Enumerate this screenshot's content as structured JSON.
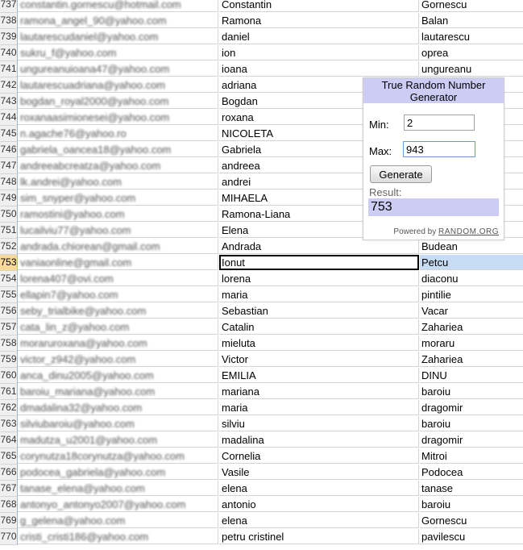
{
  "rows": [
    {
      "n": "737",
      "email": "constantin.gornescu@hotmail.com",
      "first": "Constantin",
      "last": "Gornescu"
    },
    {
      "n": "738",
      "email": "ramona_angel_90@yahoo.com",
      "first": "Ramona",
      "last": "Balan"
    },
    {
      "n": "739",
      "email": "lautarescudaniel@yahoo.com",
      "first": "daniel",
      "last": "lautarescu"
    },
    {
      "n": "740",
      "email": "sukru_f@yahoo.com",
      "first": "ion",
      "last": "oprea"
    },
    {
      "n": "741",
      "email": "ungureanuioana47@yahoo.com",
      "first": "ioana",
      "last": "ungureanu"
    },
    {
      "n": "742",
      "email": "lautarescuadriana@yahoo.com",
      "first": "adriana",
      "last": ""
    },
    {
      "n": "743",
      "email": "bogdan_royal2000@yahoo.com",
      "first": "Bogdan",
      "last": ""
    },
    {
      "n": "744",
      "email": "roxanaasimionesei@yahoo.com",
      "first": "roxana",
      "last": ""
    },
    {
      "n": "745",
      "email": "n.agache76@yahoo.ro",
      "first": "NICOLETA",
      "last": ""
    },
    {
      "n": "746",
      "email": "gabriela_oancea18@yahoo.com",
      "first": "Gabriela",
      "last": ""
    },
    {
      "n": "747",
      "email": "andreeabcreatza@yahoo.com",
      "first": "andreea",
      "last": ""
    },
    {
      "n": "748",
      "email": "lk.andrei@yahoo.com",
      "first": "andrei",
      "last": ""
    },
    {
      "n": "749",
      "email": "sim_snyper@yahoo.com",
      "first": "MIHAELA",
      "last": ""
    },
    {
      "n": "750",
      "email": "ramostini@yahoo.com",
      "first": "Ramona-Liana",
      "last": ""
    },
    {
      "n": "751",
      "email": "lucailviu77@yahoo.com",
      "first": "Elena",
      "last": ""
    },
    {
      "n": "752",
      "email": "andrada.chiorean@gmail.com",
      "first": "Andrada",
      "last": "Budean"
    },
    {
      "n": "753",
      "email": "vaniaonline@gmail.com",
      "first": "Ionut",
      "last": "Petcu"
    },
    {
      "n": "754",
      "email": "lorena407@ovi.com",
      "first": "lorena",
      "last": "diaconu"
    },
    {
      "n": "755",
      "email": "ellapin7@yahoo.com",
      "first": "maria",
      "last": "pintilie"
    },
    {
      "n": "756",
      "email": "seby_trialbike@yahoo.com",
      "first": "Sebastian",
      "last": "Vacar"
    },
    {
      "n": "757",
      "email": "cata_lin_z@yahoo.com",
      "first": "Catalin",
      "last": "Zahariea"
    },
    {
      "n": "758",
      "email": "moraruroxana@yahoo.com",
      "first": "mieluta",
      "last": "moraru"
    },
    {
      "n": "759",
      "email": "victor_z942@yahoo.com",
      "first": "Victor",
      "last": "Zahariea"
    },
    {
      "n": "760",
      "email": "anca_dinu2005@yahoo.com",
      "first": "EMILIA",
      "last": "DINU"
    },
    {
      "n": "761",
      "email": "baroiu_mariana@yahoo.com",
      "first": "mariana",
      "last": "baroiu"
    },
    {
      "n": "762",
      "email": "dmadalina32@yahoo.com",
      "first": "maria",
      "last": "dragomir"
    },
    {
      "n": "763",
      "email": "silviubaroiu@yahoo.com",
      "first": "silviu",
      "last": "baroiu"
    },
    {
      "n": "764",
      "email": "madutza_u2001@yahoo.com",
      "first": "madalina",
      "last": "dragomir"
    },
    {
      "n": "765",
      "email": "corynutza18corynutza@yahoo.com",
      "first": "Cornelia",
      "last": "Mitroi"
    },
    {
      "n": "766",
      "email": "podocea_gabriela@yahoo.com",
      "first": "Vasile",
      "last": "Podocea"
    },
    {
      "n": "767",
      "email": "tanase_elena@yahoo.com",
      "first": "elena",
      "last": "tanase"
    },
    {
      "n": "768",
      "email": "antonyo_antonyo2007@yahoo.com",
      "first": "antonio",
      "last": "baroiu"
    },
    {
      "n": "769",
      "email": "g_gelena@yahoo.com",
      "first": "elena",
      "last": "Gornescu"
    },
    {
      "n": "770",
      "email": "cristi_cristi186@yahoo.com",
      "first": "petru cristinel",
      "last": "pavilescu"
    }
  ],
  "selected_row": "753",
  "rng": {
    "title": "True Random Number Generator",
    "min_label": "Min:",
    "min_value": "2",
    "max_label": "Max:",
    "max_value": "943",
    "generate_label": "Generate",
    "result_label": "Result:",
    "result_value": "753",
    "powered_prefix": "Powered by",
    "powered_brand": "RANDOM.ORG"
  }
}
